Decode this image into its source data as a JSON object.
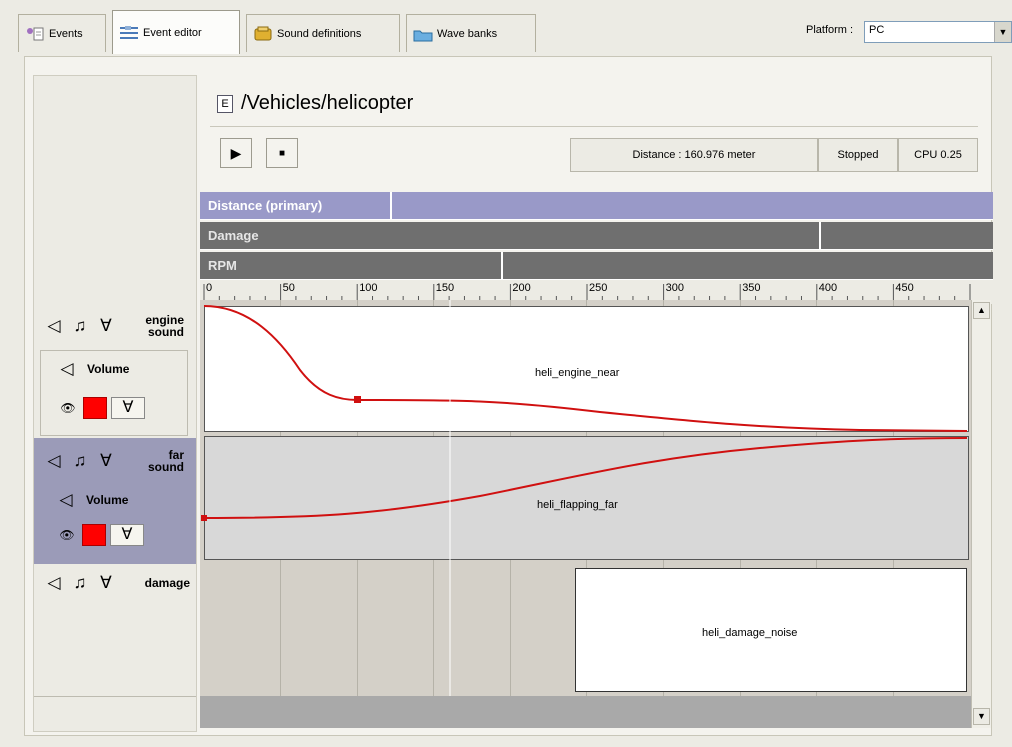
{
  "tabs": [
    {
      "label": "Events",
      "icon": "events-icon"
    },
    {
      "label": "Event editor",
      "icon": "event-editor-icon"
    },
    {
      "label": "Sound definitions",
      "icon": "sound-definitions-icon"
    },
    {
      "label": "Wave banks",
      "icon": "wave-banks-icon"
    }
  ],
  "platform": {
    "label": "Platform :",
    "value": "PC"
  },
  "event": {
    "badge": "E",
    "path": "/Vehicles/helicopter"
  },
  "status": {
    "distance": "Distance : 160.976 meter",
    "state": "Stopped",
    "cpu": "CPU 0.25"
  },
  "parameters": [
    {
      "name": "Distance (primary)",
      "cursor": 0.24
    },
    {
      "name": "Damage",
      "cursor": 0.78
    },
    {
      "name": "RPM",
      "cursor": 0.38
    }
  ],
  "ruler": [
    "0",
    "50",
    "100",
    "150",
    "200",
    "250",
    "300",
    "350",
    "400",
    "450"
  ],
  "layers": [
    {
      "name": "engine sound",
      "name_line1": "engine",
      "name_line2": "sound",
      "effect": "Volume",
      "sound": "heli_engine_near"
    },
    {
      "name": "far sound",
      "name_line1": "far",
      "name_line2": "sound",
      "effect": "Volume",
      "sound": "heli_flapping_far"
    },
    {
      "name": "damage",
      "name_line1": "damage",
      "name_line2": "",
      "effect": "",
      "sound": "heli_damage_noise"
    }
  ],
  "colors": {
    "primary_param": "#9999c8",
    "param": "#6f6f6f",
    "curve": "#d01010",
    "effect_color": "#ff0000"
  }
}
